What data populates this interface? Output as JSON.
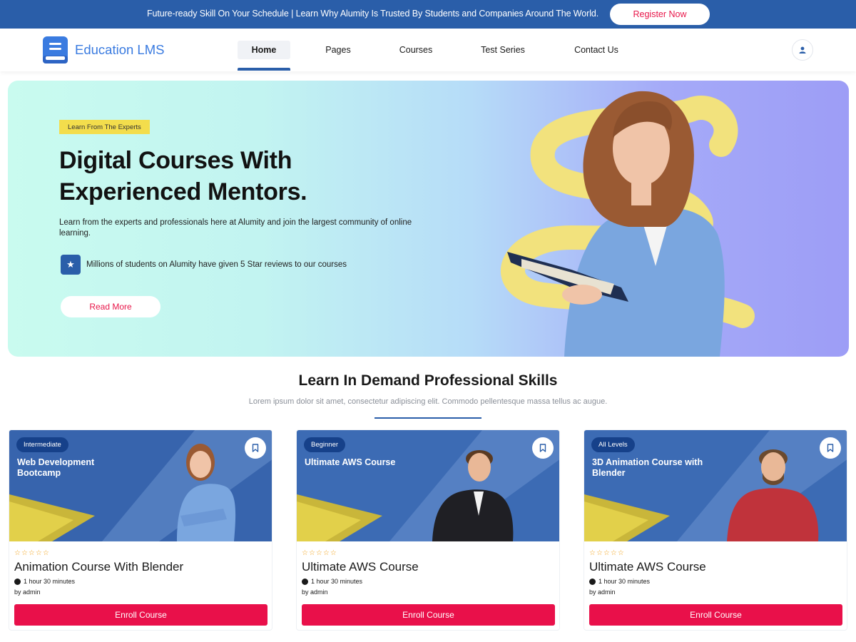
{
  "topbar": {
    "announcement": "Future-ready Skill On Your Schedule | Learn Why Alumity Is Trusted By Students and Companies Around The World.",
    "register_label": "Register Now"
  },
  "header": {
    "logo_text": "Education LMS",
    "nav": [
      "Home",
      "Pages",
      "Courses",
      "Test Series",
      "Contact Us"
    ],
    "active_nav": "Home"
  },
  "hero": {
    "badge": "Learn From The Experts",
    "title_line1": "Digital Courses With",
    "title_line2": "Experienced Mentors.",
    "description": "Learn from the experts and professionals here at Alumity and join the largest community of online learning.",
    "feature": "Millions of students on Alumity have given 5 Star reviews to our courses",
    "cta_label": "Read More"
  },
  "section": {
    "title": "Learn In Demand Professional Skills",
    "subtitle": "Lorem ipsum dolor sit amet, consectetur adipiscing elit. Commodo pellentesque massa tellus ac augue."
  },
  "courses": [
    {
      "level": "Intermediate",
      "image_title": "Web Development Bootcamp",
      "rating": "☆☆☆☆☆",
      "title": "Animation Course With Blender",
      "duration": "1 hour 30 minutes",
      "author": "by admin",
      "enroll_label": "Enroll Course"
    },
    {
      "level": "Beginner",
      "image_title": "Ultimate AWS Course",
      "rating": "☆☆☆☆☆",
      "title": "Ultimate AWS Course",
      "duration": "1 hour 30 minutes",
      "author": "by admin",
      "enroll_label": "Enroll Course"
    },
    {
      "level": "All Levels",
      "image_title": "3D Animation Course with Blender",
      "rating": "☆☆☆☆☆",
      "title": "Ultimate AWS Course",
      "duration": "1 hour 30 minutes",
      "author": "by admin",
      "enroll_label": "Enroll Course"
    }
  ],
  "colors": {
    "primary_blue": "#2a5ea9",
    "accent_red": "#e9104a",
    "badge_yellow": "#f3dd4c",
    "logo_blue": "#3a7be0"
  },
  "icons": [
    "book-logo-icon",
    "user-icon",
    "star-icon",
    "bookmark-icon",
    "clock-icon"
  ]
}
